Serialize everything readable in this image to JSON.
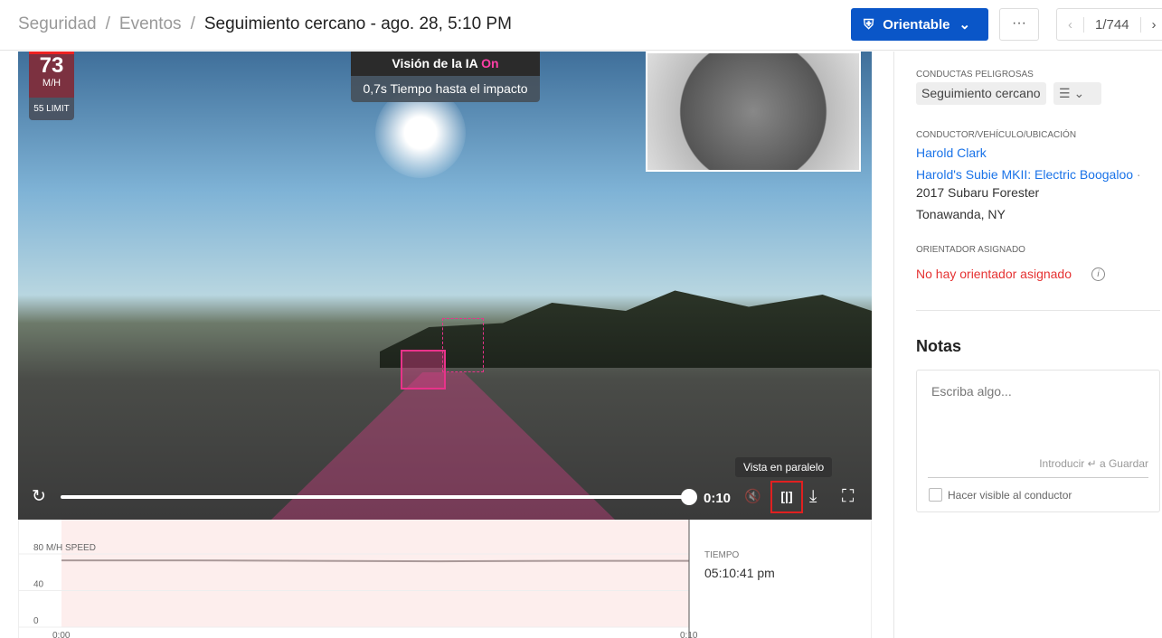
{
  "breadcrumb": {
    "items": [
      "Seguridad",
      "Eventos"
    ],
    "separator": "/",
    "current": "Seguimiento cercano - ago. 28, 5:10 PM"
  },
  "header": {
    "coach_button": "Orientable",
    "more": "···",
    "pager": "1/744",
    "prev": "‹",
    "next": "›"
  },
  "video": {
    "speed": "73",
    "speed_unit": "M/H",
    "limit": "55 LIMIT",
    "ai_label": "Visión de la IA",
    "ai_state": "On",
    "impact": "0,7s Tiempo hasta el impacto",
    "time": "0:10",
    "progress": 1.0,
    "tooltip": "Vista en paralelo",
    "icons": {
      "replay": "↻",
      "mute": "🔇",
      "side_by_side": "[|]",
      "download": "⤓",
      "fullscreen": "⛶"
    }
  },
  "chart_data": {
    "type": "line",
    "title": "",
    "ylabel": "M/H SPEED",
    "y_ticks": [
      "80 M/H SPEED",
      "40",
      "0"
    ],
    "ylim": [
      0,
      80
    ],
    "x_ticks": [
      "0:00",
      "0:10"
    ],
    "x": [
      0,
      2,
      4,
      6,
      8,
      10
    ],
    "values": [
      73,
      73,
      72.5,
      72,
      72.5,
      72.5
    ],
    "highlight": [
      0,
      10
    ],
    "highlight_color": "#fdeeed"
  },
  "chart_side": {
    "label": "TIEMPO",
    "value": "05:10:41 pm"
  },
  "sidebar": {
    "behaviors_label": "CONDUCTAS PELIGROSAS",
    "behavior": "Seguimiento cercano",
    "driver_label": "CONDUCTOR/VEHÍCULO/UBICACIÓN",
    "driver": "Harold Clark",
    "vehicle": "Harold's Subie MKII: Electric Boogaloo",
    "dot": "·",
    "model": "2017 Subaru Forester",
    "location": "Tonawanda, NY",
    "coach_label": "ORIENTADOR ASIGNADO",
    "coach": "No hay orientador asignado",
    "notes_title": "Notas",
    "notes_placeholder": "Escriba algo...",
    "notes_hint": "Introducir ↵ a Guardar",
    "visible_label": "Hacer visible al conductor"
  }
}
